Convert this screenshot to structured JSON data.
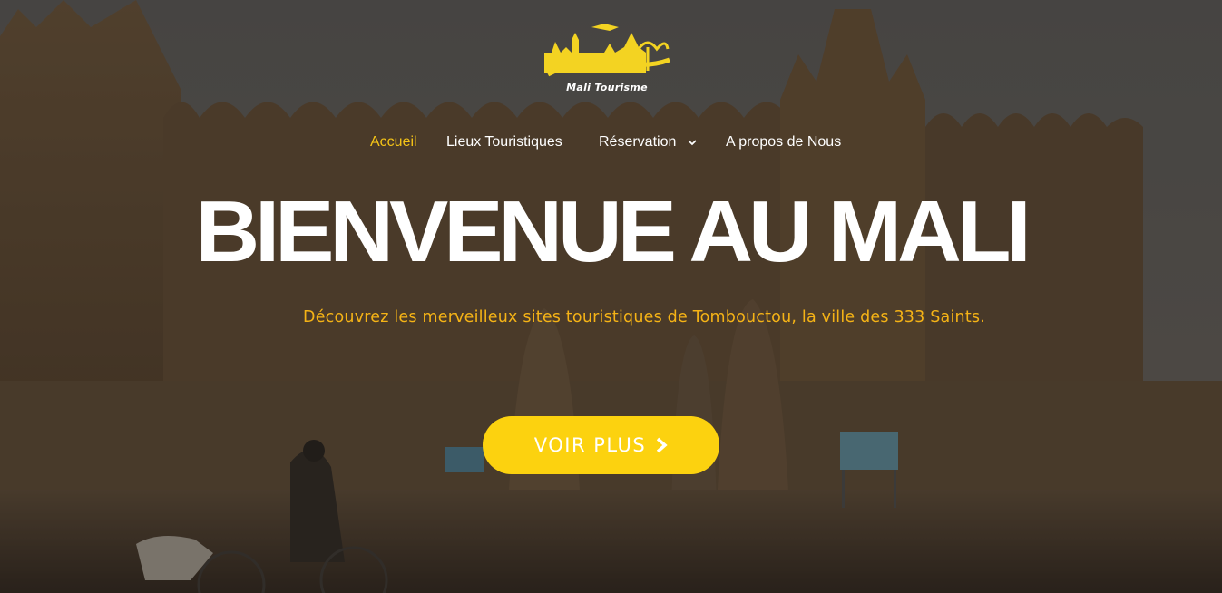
{
  "brand": {
    "name": "Mali Tourisme"
  },
  "nav": {
    "items": [
      {
        "label": "Accueil",
        "active": true
      },
      {
        "label": "Lieux Touristiques"
      },
      {
        "label": "Réservation",
        "has_dropdown": true
      },
      {
        "label": "A propos de Nous"
      }
    ]
  },
  "hero": {
    "title": "BIENVENUE AU MALI",
    "subtitle": "Découvrez les merveilleux sites touristiques de Tombouctou, la ville des 333 Saints.",
    "cta_label": "VOIR PLUS",
    "cta_icon": "chevron-right-icon"
  },
  "colors": {
    "accent": "#f5c417",
    "cta_background": "#fcd20f",
    "subtitle": "#f5b316"
  }
}
